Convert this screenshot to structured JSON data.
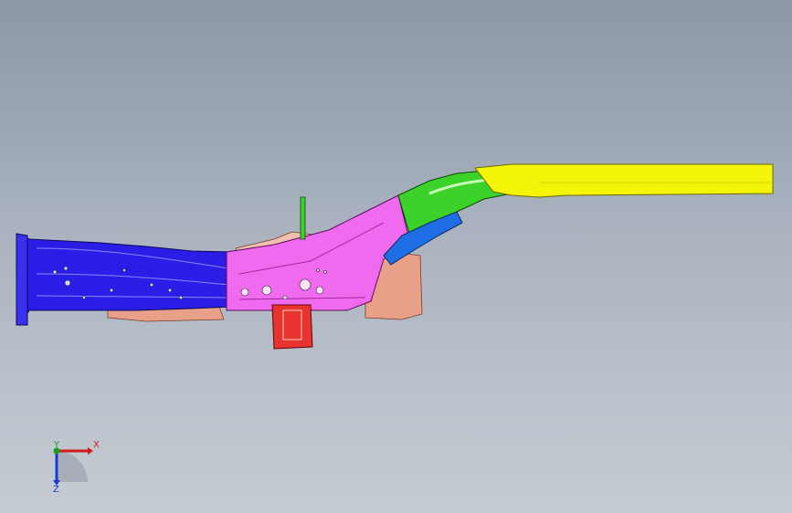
{
  "viewport": {
    "background_top": "#8c98a7",
    "background_bottom": "#c6ccd3"
  },
  "model": {
    "part_colors": {
      "front_rail_blue": "#2a1ee6",
      "mid_section_magenta": "#f06af0",
      "bracket_red": "#e8332e",
      "reinforcement_salmon": "#e9a089",
      "kickup_green": "#3cd22a",
      "inner_blue": "#1e6ee6",
      "rear_rail_yellow": "#f5f50a"
    }
  },
  "triad": {
    "x_label": "X",
    "y_label": "Y",
    "z_label": "Z",
    "x_color": "#d31a1a",
    "y_color": "#1b9b1b",
    "z_color": "#1a3bd1"
  }
}
